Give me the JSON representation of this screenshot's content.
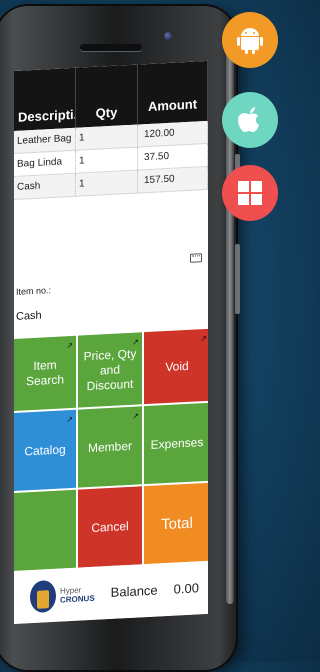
{
  "table": {
    "columns": [
      "Descripti...",
      "Qty",
      "Amount"
    ],
    "rows": [
      {
        "description": "Leather Bag ...",
        "qty": "1",
        "amount": "120.00"
      },
      {
        "description": "Bag Linda",
        "qty": "1",
        "amount": "37.50"
      },
      {
        "description": "Cash",
        "qty": "1",
        "amount": "157.50"
      }
    ]
  },
  "item": {
    "label": "Item no.:",
    "value": "Cash"
  },
  "buttons": {
    "item_search": "Item Search",
    "price_qty": "Price, Qty and Discount",
    "void": "Void",
    "catalog": "Catalog",
    "member": "Member",
    "expenses": "Expenses",
    "cancel": "Cancel",
    "total": "Total"
  },
  "footer": {
    "brand_top": "Hyper",
    "brand_bottom": "CRONUS",
    "balance_label": "Balance",
    "balance_value": "0.00"
  },
  "colors": {
    "green": "#5aa63d",
    "red": "#cf3429",
    "blue": "#2f8fd6",
    "orange": "#f08c21"
  },
  "icons": [
    "android-icon",
    "apple-icon",
    "windows-icon",
    "keyboard-icon"
  ]
}
